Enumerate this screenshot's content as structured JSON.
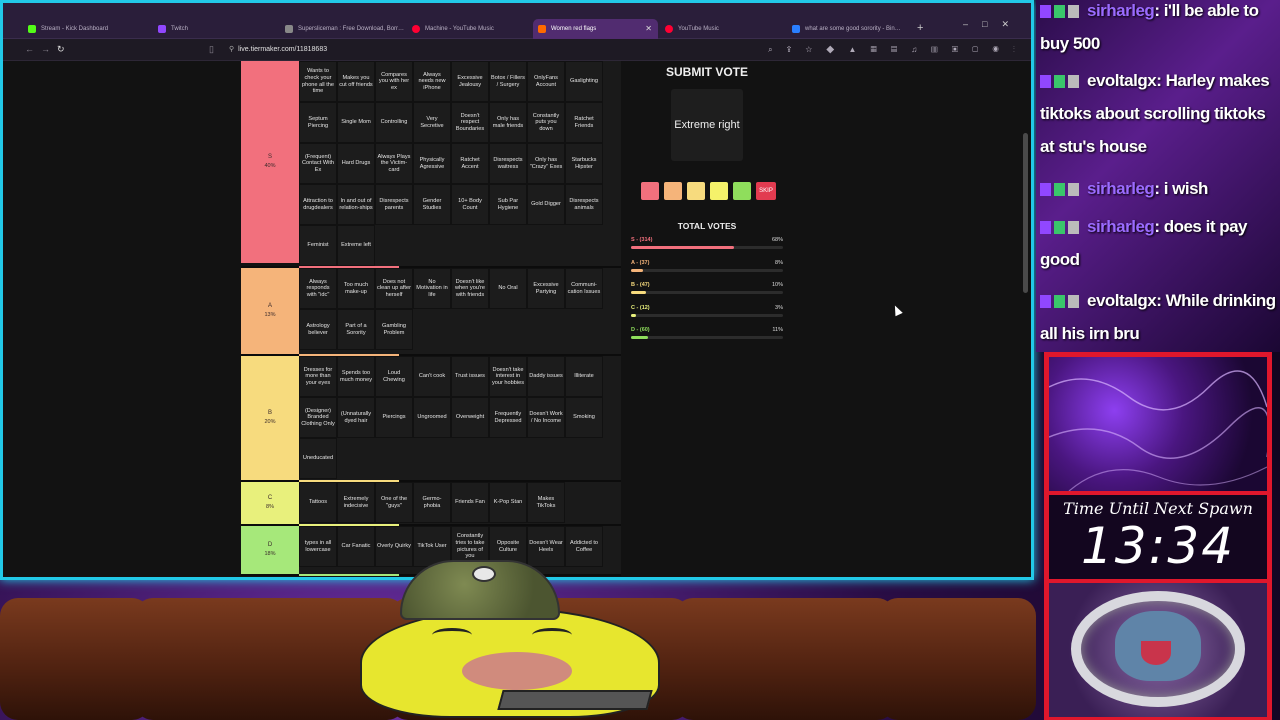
{
  "browser": {
    "tabs": [
      {
        "label": "Stream - Kick Dashboard",
        "color": "#53fc18"
      },
      {
        "label": "Twitch",
        "color": "#9147ff"
      },
      {
        "label": "Supersliceman : Free Download, Borr…",
        "color": "#888888"
      },
      {
        "label": "Machine - YouTube Music",
        "color": "#ff0033"
      },
      {
        "label": "Women red flags",
        "color": "#ff6a00",
        "active": true
      },
      {
        "label": "YouTube Music",
        "color": "#ff0033"
      },
      {
        "label": "what are some good sorority - Bin…",
        "color": "#2a7fff"
      }
    ],
    "url": "live.tiermaker.com/11818683"
  },
  "tiers": [
    {
      "id": "s",
      "label": "S",
      "pct": "40%",
      "color": "#f2707d",
      "items": [
        "Wants to check your phone all the time",
        "Makes you cut off friends",
        "Compares you with her ex",
        "Always needs new iPhone",
        "Excessive Jealousy",
        "Botox / Fillers / Surgery",
        "OnlyFans Account",
        "Gaslighting",
        "Septum Piercing",
        "Single Mom",
        "Controlling",
        "Very Secretive",
        "Doesn't respect Boundaries",
        "Only has male friends",
        "Constantly puts you down",
        "Ratchet Friends",
        "(Frequent) Contact With Ex",
        "Hard Drugs",
        "Always Plays the Victim-card",
        "Physically Agressive",
        "Ratchet Accent",
        "Disrespects waitress",
        "Only has \"Crazy\" Exes",
        "Starbucks Hipster",
        "Attraction to drugdealers",
        "In and out of relation-ships",
        "Disrespects parents",
        "Gender Studies",
        "10+ Body Count",
        "Sub Par Hygiene",
        "Gold Digger",
        "Disrespects animals",
        "Feminist",
        "Extreme left"
      ]
    },
    {
      "id": "a",
      "label": "A",
      "pct": "13%",
      "color": "#f5b47a",
      "items": [
        "Always responds with \"idc\"",
        "Too much make-up",
        "Does not clean up after herself",
        "No Motivation in life",
        "Doesn't like when you're with friends",
        "No Oral",
        "Excessive Partying",
        "Communi-cation Issues",
        "Astrology believer",
        "Part of a Sorority",
        "Gambling Problem"
      ]
    },
    {
      "id": "b",
      "label": "B",
      "pct": "20%",
      "color": "#f7db7e",
      "items": [
        "Dresses for more than your eyes",
        "Spends too much money",
        "Loud Chewing",
        "Can't cook",
        "Trust issues",
        "Doesn't take interest in your hobbies",
        "Daddy issues",
        "Illiterate",
        "(Designer) Branded Clothing Only",
        "(Unnaturally dyed hair",
        "Piercings",
        "Ungroomed",
        "Overweight",
        "Frequently Depressed",
        "Doesn't Work / No Income",
        "Smoking",
        "Uneducated"
      ]
    },
    {
      "id": "c",
      "label": "C",
      "pct": "8%",
      "color": "#e8f07c",
      "items": [
        "Tattoos",
        "Extremely indecisive",
        "One of the \"guys\"",
        "Germo-phobia",
        "Friends Fan",
        "K-Pop Stan",
        "Makes TikToks"
      ]
    },
    {
      "id": "d",
      "label": "D",
      "pct": "18%",
      "color": "#a6e87a",
      "items": [
        "types in all lowercase",
        "Car Fanatic",
        "Overly Quirky",
        "TikTok User",
        "Constantly tries to take pictures of you",
        "Opposite Culture",
        "Doesn't Wear Heels",
        "Addicted to Coffee"
      ]
    }
  ],
  "vote": {
    "title": "SUBMIT VOTE",
    "current_item": "Extreme right",
    "skip_label": "SKIP",
    "swatch_colors": [
      "#f2707d",
      "#f5b47a",
      "#f7db7e",
      "#f5f26a",
      "#8fde5c"
    ],
    "total_title": "TOTAL VOTES",
    "results": [
      {
        "label": "S - (314)",
        "pct": "68%",
        "fraction": 0.68,
        "color": "#f2707d"
      },
      {
        "label": "A - (37)",
        "pct": "8%",
        "fraction": 0.08,
        "color": "#f5b47a"
      },
      {
        "label": "B - (47)",
        "pct": "10%",
        "fraction": 0.1,
        "color": "#f7db7e"
      },
      {
        "label": "C - (12)",
        "pct": "3%",
        "fraction": 0.03,
        "color": "#e8f07c"
      },
      {
        "label": "D - (60)",
        "pct": "11%",
        "fraction": 0.11,
        "color": "#8fde5c"
      }
    ]
  },
  "chat": [
    {
      "user": "sirharleg",
      "text": ": i'll be able to buy 500",
      "user_color": "#9b6bff"
    },
    {
      "user": "evoltalgx",
      "text": ": Harley makes tiktoks about scrolling tiktoks at stu's house",
      "user_color": "#ffffff"
    },
    {
      "user": "sirharleg",
      "text": ": i wish",
      "user_color": "#9b6bff"
    },
    {
      "user": "sirharleg",
      "text": ": does it pay good",
      "user_color": "#9b6bff"
    },
    {
      "user": "evoltalgx",
      "text": ": While drinking all his irn bru",
      "user_color": "#ffffff"
    }
  ],
  "spawn": {
    "label": "Time Until Next Spawn",
    "time": "13:34"
  }
}
